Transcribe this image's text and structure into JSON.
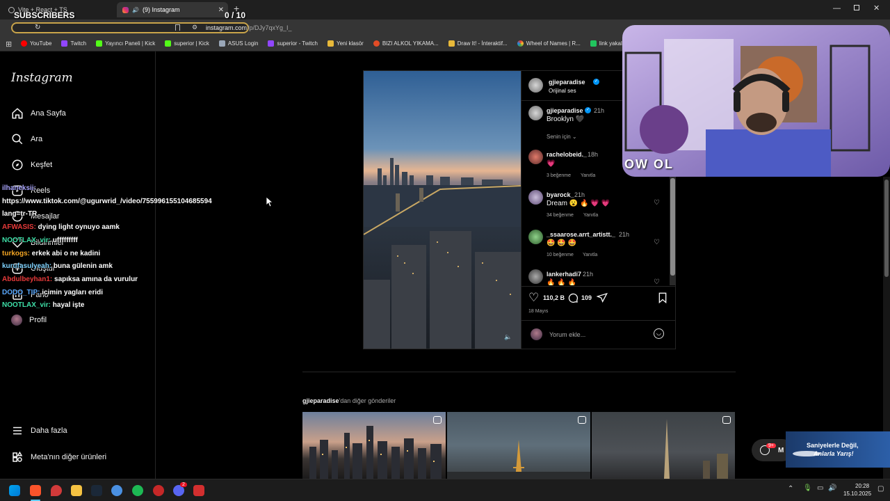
{
  "browser": {
    "tabs": [
      {
        "label": "Vite + React + TS"
      },
      {
        "label": "(9) Instagram"
      }
    ],
    "url_host": "instagram.com",
    "url_path": "/p/DJy7qxYg_I_",
    "bookmarks": [
      {
        "label": "YouTube",
        "color": "#ff0000"
      },
      {
        "label": "Twitch",
        "color": "#9146ff"
      },
      {
        "label": "Yayıncı Paneli | Kick",
        "color": "#53fc18"
      },
      {
        "label": "superior | Kick",
        "color": "#53fc18"
      },
      {
        "label": "ASUS Login",
        "color": "#9aa7b8"
      },
      {
        "label": "superior - Twitch",
        "color": "#9146ff"
      },
      {
        "label": "Yeni klasör",
        "color": "#e8b93a"
      },
      {
        "label": "BIZI ALKOL YIKAMA...",
        "color": "#e34c26"
      },
      {
        "label": "Draw It! - İnteraktif...",
        "color": "#e8b93a"
      },
      {
        "label": "Wheel of Names | R...",
        "color": "#4caf50"
      },
      {
        "label": "link yakalama",
        "color": "#22c55e"
      }
    ]
  },
  "overlay": {
    "subscribers_label": "SUBSCRIBERS",
    "subscribers_count": "0 / 10"
  },
  "sidebar": {
    "logo": "Instagram",
    "items": [
      {
        "label": "Ana Sayfa",
        "icon": "home-icon"
      },
      {
        "label": "Ara",
        "icon": "search-icon"
      },
      {
        "label": "Keşfet",
        "icon": "compass-icon"
      },
      {
        "label": "Reels",
        "icon": "reels-icon"
      },
      {
        "label": "Mesajlar",
        "icon": "messenger-icon"
      },
      {
        "label": "Bildirimler",
        "icon": "heart-icon"
      },
      {
        "label": "Oluştur",
        "icon": "plus-icon"
      },
      {
        "label": "Pano",
        "icon": "dashboard-icon"
      },
      {
        "label": "Profil",
        "icon": "profile-avatar"
      }
    ],
    "more": "Daha fazla",
    "meta": "Meta'nın diğer ürünleri"
  },
  "post": {
    "author": "gjieparadise",
    "audio": "Orijinal ses",
    "caption_user": "gjieparadise",
    "caption_time": "21h",
    "caption_text": "Brooklyn 🖤",
    "translation_toggle": "Senin için",
    "comments": [
      {
        "user": "rachelobeid._",
        "time": "18h",
        "text": "💗",
        "likes": "3 beğenme",
        "reply": "Yanıtla"
      },
      {
        "user": "byarock_",
        "time": "21h",
        "text": "Dream 😮 🔥 💗 💗",
        "likes": "34 beğenme",
        "reply": "Yanıtla"
      },
      {
        "user": "_ssaarose.arrt_artistt._",
        "time": "21h",
        "text": "🤩 🤩 🤩",
        "likes": "10 beğenme",
        "reply": "Yanıtla"
      },
      {
        "user": "lankerhadi7",
        "time": "21h",
        "text": "🔥 🔥 🔥",
        "likes": "",
        "reply": ""
      }
    ],
    "likes": "110,2 B",
    "comments_count": "109",
    "date": "18 Mayıs",
    "comment_placeholder": "Yorum ekle..."
  },
  "more_posts": {
    "author": "gjieparadise",
    "suffix": "'dan diğer gönderiler"
  },
  "chat": [
    {
      "user": "ilhaneksii:",
      "user_color": "#aaa6ff",
      "msg": ""
    },
    {
      "user": "",
      "user_color": "#ffffff",
      "msg": "https://www.tiktok.com/@ugurwrid_/video/755996155104685594"
    },
    {
      "user": "",
      "user_color": "#ffffff",
      "msg": "lang=tr-TR"
    },
    {
      "user": "AFWASIS:",
      "user_color": "#e83a3a",
      "msg": "dying light oynuyo aamk"
    },
    {
      "user": "NOOTLAX_vir:",
      "user_color": "#3ee0a8",
      "msg": "ufffffffff"
    },
    {
      "user": "turkogs:",
      "user_color": "#f5a623",
      "msg": "erkek abi o ne kadini"
    },
    {
      "user": "kurufasulyeah:",
      "user_color": "#7fd3ff",
      "msg": "buna gülenin amk"
    },
    {
      "user": "Abdulbeyhan1:",
      "user_color": "#e83a3a",
      "msg": "sapıksa amına da vurulur"
    },
    {
      "user": "DODO_TIP:",
      "user_color": "#5aa9ff",
      "msg": "icimin yagları eridi"
    },
    {
      "user": "NOOTLAX_vir:",
      "user_color": "#3ee0a8",
      "msg": "hayal işte"
    }
  ],
  "webcam": {
    "logo": "OW OL"
  },
  "promo": {
    "line1": "Saniyelerle Değil,",
    "line2": "Anlarla Yarış!",
    "messages_badge": "9+",
    "messages_label": "M"
  },
  "taskbar": {
    "time": "20:28",
    "date": "15.10.2025",
    "discord_badge": "2"
  },
  "colors": {
    "ig_bg": "#000000",
    "ig_border": "#262626",
    "url_outline": "#c9a44a",
    "verified": "#0095f6"
  }
}
